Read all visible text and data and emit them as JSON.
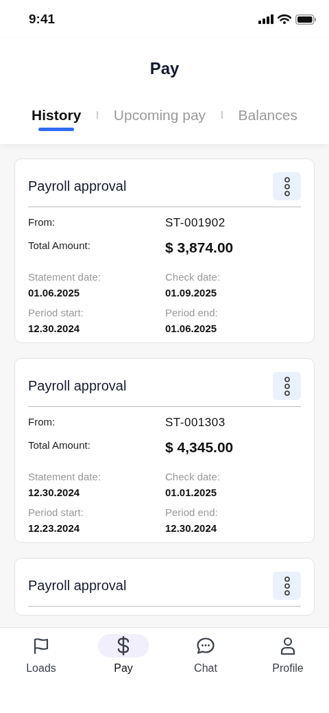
{
  "status_bar": {
    "time": "9:41"
  },
  "header": {
    "title": "Pay"
  },
  "tabs": [
    {
      "label": "History",
      "selected": true
    },
    {
      "label": "Upcoming pay",
      "selected": false
    },
    {
      "label": "Balances",
      "selected": false
    }
  ],
  "cards": [
    {
      "title": "Payroll approval",
      "from_label": "From:",
      "from": "ST-001902",
      "amount_label": "Total Amount:",
      "amount": "$ 3,874.00",
      "details": [
        {
          "label": "Statement date:",
          "value": "01.06.2025"
        },
        {
          "label": "Check date:",
          "value": "01.09.2025"
        },
        {
          "label": "Period start:",
          "value": "12.30.2024"
        },
        {
          "label": "Period end:",
          "value": "01.06.2025"
        }
      ]
    },
    {
      "title": "Payroll approval",
      "from_label": "From:",
      "from": "ST-001303",
      "amount_label": "Total Amount:",
      "amount": "$ 4,345.00",
      "details": [
        {
          "label": "Statement date:",
          "value": "12.30.2024"
        },
        {
          "label": "Check date:",
          "value": "01.01.2025"
        },
        {
          "label": "Period start:",
          "value": "12.23.2024"
        },
        {
          "label": "Period end:",
          "value": "12.30.2024"
        }
      ]
    },
    {
      "title": "Payroll approval"
    }
  ],
  "nav": [
    {
      "label": "Loads",
      "selected": false
    },
    {
      "label": "Pay",
      "selected": true
    },
    {
      "label": "Chat",
      "selected": false
    },
    {
      "label": "Profile",
      "selected": false
    }
  ]
}
